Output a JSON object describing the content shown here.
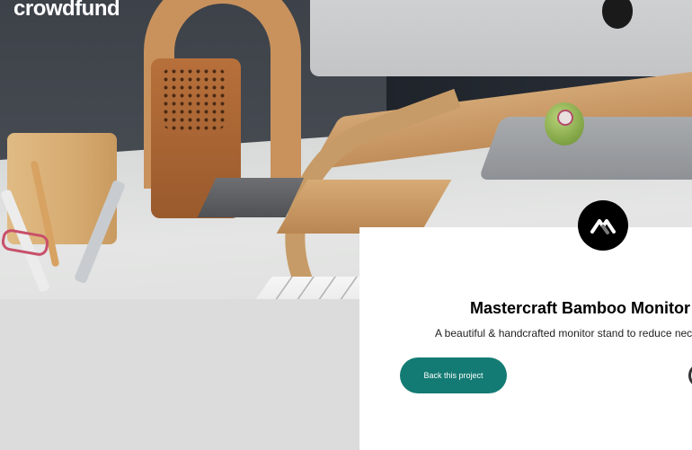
{
  "header": {
    "logo_text": "crowdfund"
  },
  "hero": {
    "image_alt": "product-photo"
  },
  "project": {
    "logo_icon": "mastercraft-logo-icon",
    "title": "Mastercraft Bamboo Monitor",
    "description": "A beautiful & handcrafted monitor stand to reduce nec",
    "back_button_label": "Back this project",
    "bookmark_icon": "bookmark-icon"
  },
  "colors": {
    "accent": "#147b74",
    "card_background": "#ffffff",
    "page_background": "#dcdcdc",
    "logo_circle": "#000000"
  }
}
